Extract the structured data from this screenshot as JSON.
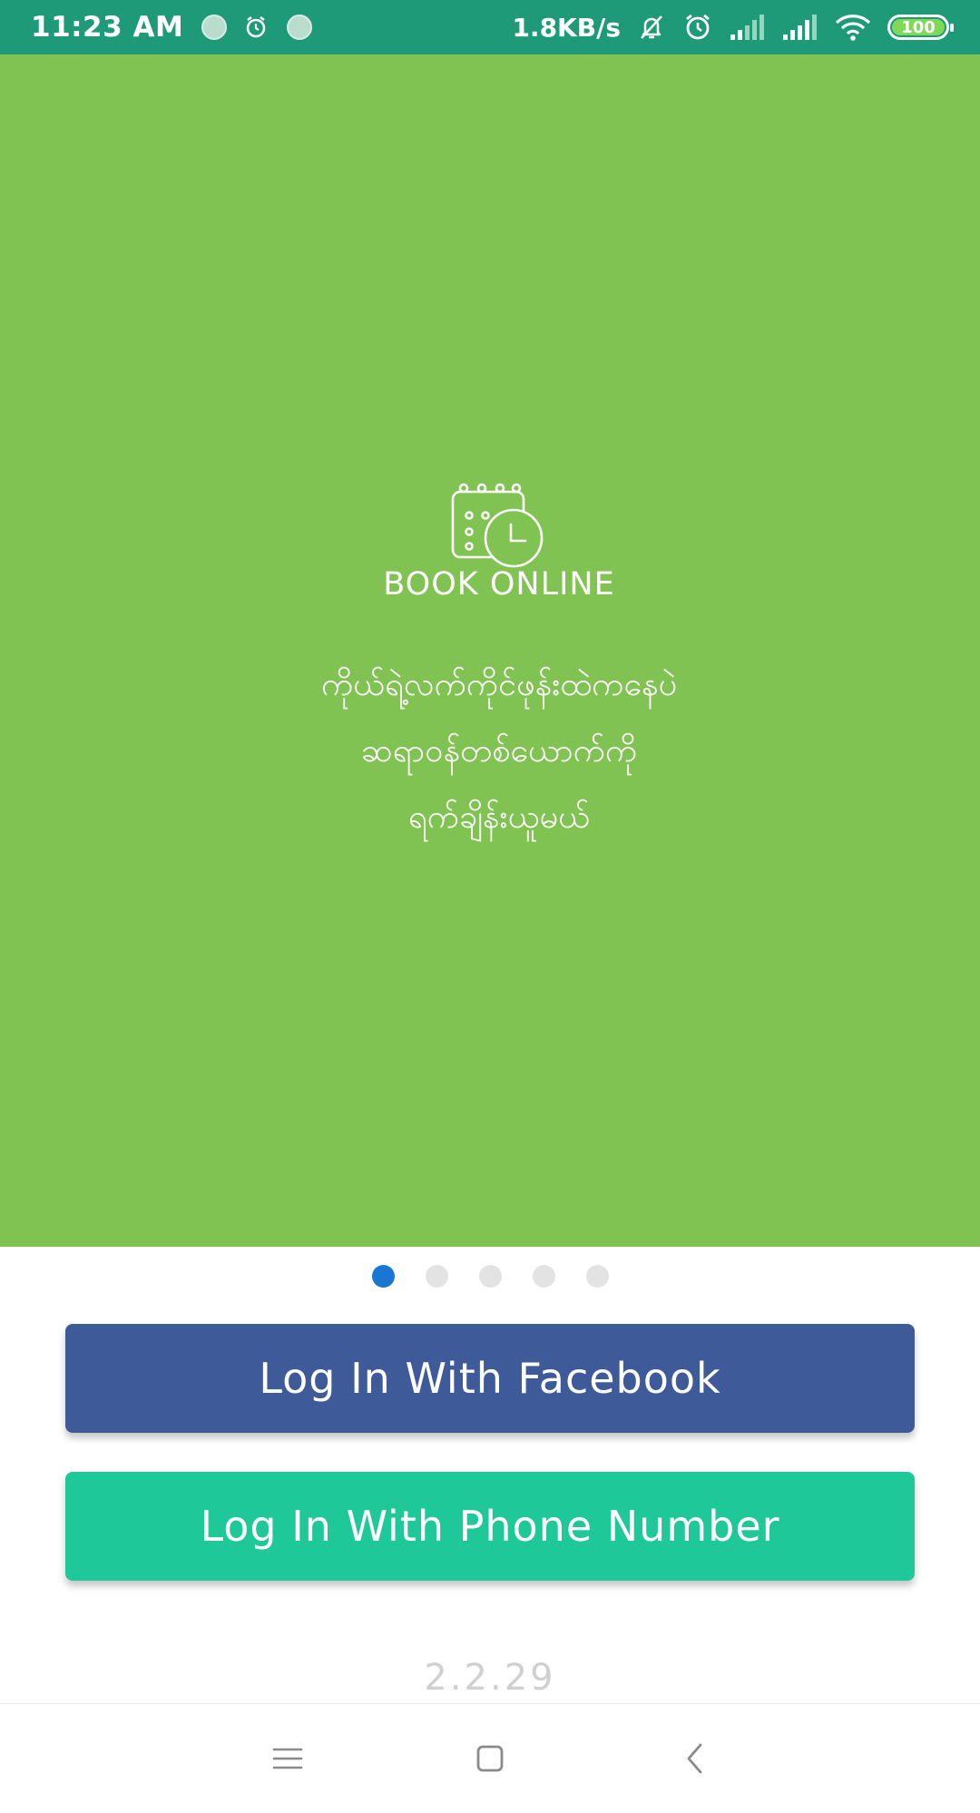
{
  "status_bar": {
    "time": "11:23 AM",
    "net_speed": "1.8KB/s",
    "battery_level": "100",
    "icons": [
      "notification-dot-icon",
      "alarm-icon",
      "notification-dot-icon",
      "bell-muted-icon",
      "alarm-icon",
      "signal-icon",
      "signal-icon",
      "wifi-icon",
      "battery-icon"
    ]
  },
  "onboarding": {
    "icon": "calendar-clock-icon",
    "title": "BOOK ONLINE",
    "description_lines": [
      "ကိုယ်ရဲ့လက်ကိုင်ဖုန်းထဲကနေပဲ",
      "ဆရာဝန်တစ်ယောက်ကို",
      "ရက်ချိန်းယူမယ်"
    ],
    "background_color": "#80c353"
  },
  "pager": {
    "total": 5,
    "active_index": 0,
    "active_color": "#1976d2"
  },
  "buttons": {
    "facebook_label": "Log In With Facebook",
    "phone_label": "Log In With Phone Number",
    "facebook_color": "#3e5a98",
    "phone_color": "#1fc899"
  },
  "footer": {
    "version_text": "2.2.29"
  },
  "nav_bar": {
    "icons": [
      "menu-icon",
      "home-square-icon",
      "back-chevron-icon"
    ]
  }
}
